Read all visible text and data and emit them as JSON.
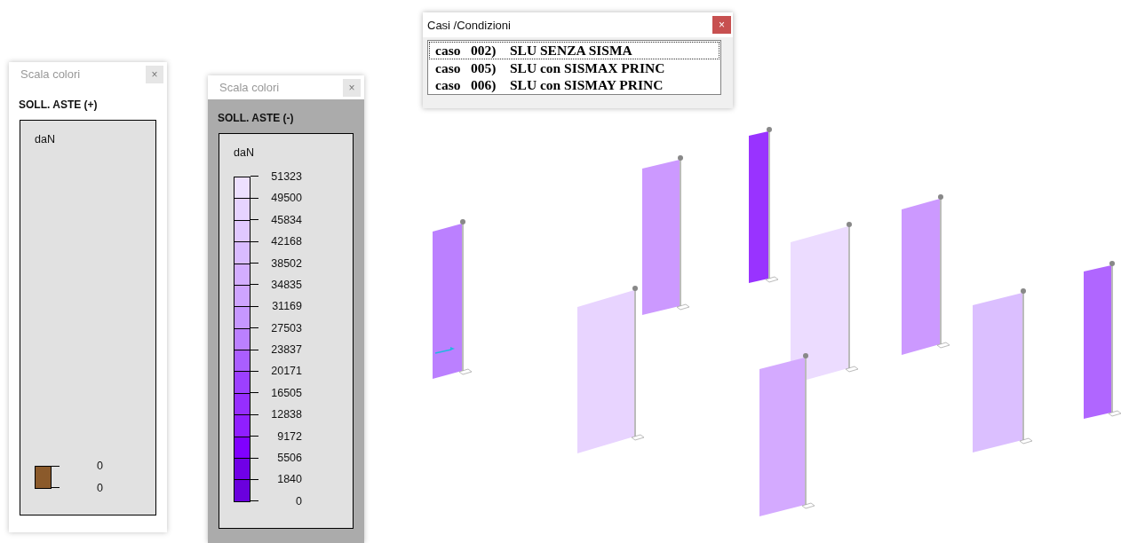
{
  "scale_windows": [
    {
      "title": "Scala colori",
      "close": "×",
      "highlighted": false,
      "heading": "SOLL. ASTE (+)",
      "unit": "daN",
      "labels": [
        "0",
        "0"
      ],
      "bands": [
        {
          "color": "#8b5a2b"
        }
      ]
    },
    {
      "title": "Scala colori",
      "close": "×",
      "highlighted": true,
      "heading": "SOLL. ASTE (-)",
      "unit": "daN",
      "labels": [
        "51323",
        "49500",
        "45834",
        "42168",
        "38502",
        "34835",
        "31169",
        "27503",
        "23837",
        "20171",
        "16505",
        "12838",
        "9172",
        "5506",
        "1840",
        "0"
      ],
      "bands": [
        {
          "color": "#ede0ff"
        },
        {
          "color": "#e6d3ff"
        },
        {
          "color": "#e0c8ff"
        },
        {
          "color": "#d9bbff"
        },
        {
          "color": "#d3adff"
        },
        {
          "color": "#cea4ff"
        },
        {
          "color": "#c697ff"
        },
        {
          "color": "#bb80ff"
        },
        {
          "color": "#aa5eff"
        },
        {
          "color": "#9c40ff"
        },
        {
          "color": "#962efe"
        },
        {
          "color": "#901fff"
        },
        {
          "color": "#8000ff"
        },
        {
          "color": "#7000e6"
        },
        {
          "color": "#6a00dd"
        }
      ]
    }
  ],
  "cases_window": {
    "title": "Casi /Condizioni",
    "close": "×",
    "active": true,
    "rows": [
      {
        "text": "caso   002)    SLU SENZA SISMA",
        "focused": true
      },
      {
        "text": "caso   005)    SLU con SISMAX PRINC",
        "focused": false
      },
      {
        "text": "caso   006)    SLU con SISMAY PRINC",
        "focused": false
      }
    ]
  },
  "model_view": {
    "panels": [
      {
        "color": "#bb80ff"
      },
      {
        "color": "#cc99ff"
      },
      {
        "color": "#9933ff"
      },
      {
        "color": "#e8d4ff"
      },
      {
        "color": "#ecdcff"
      },
      {
        "color": "#cc99ff"
      },
      {
        "color": "#d4aaff"
      },
      {
        "color": "#dbbfff"
      },
      {
        "color": "#b066ff"
      }
    ]
  }
}
